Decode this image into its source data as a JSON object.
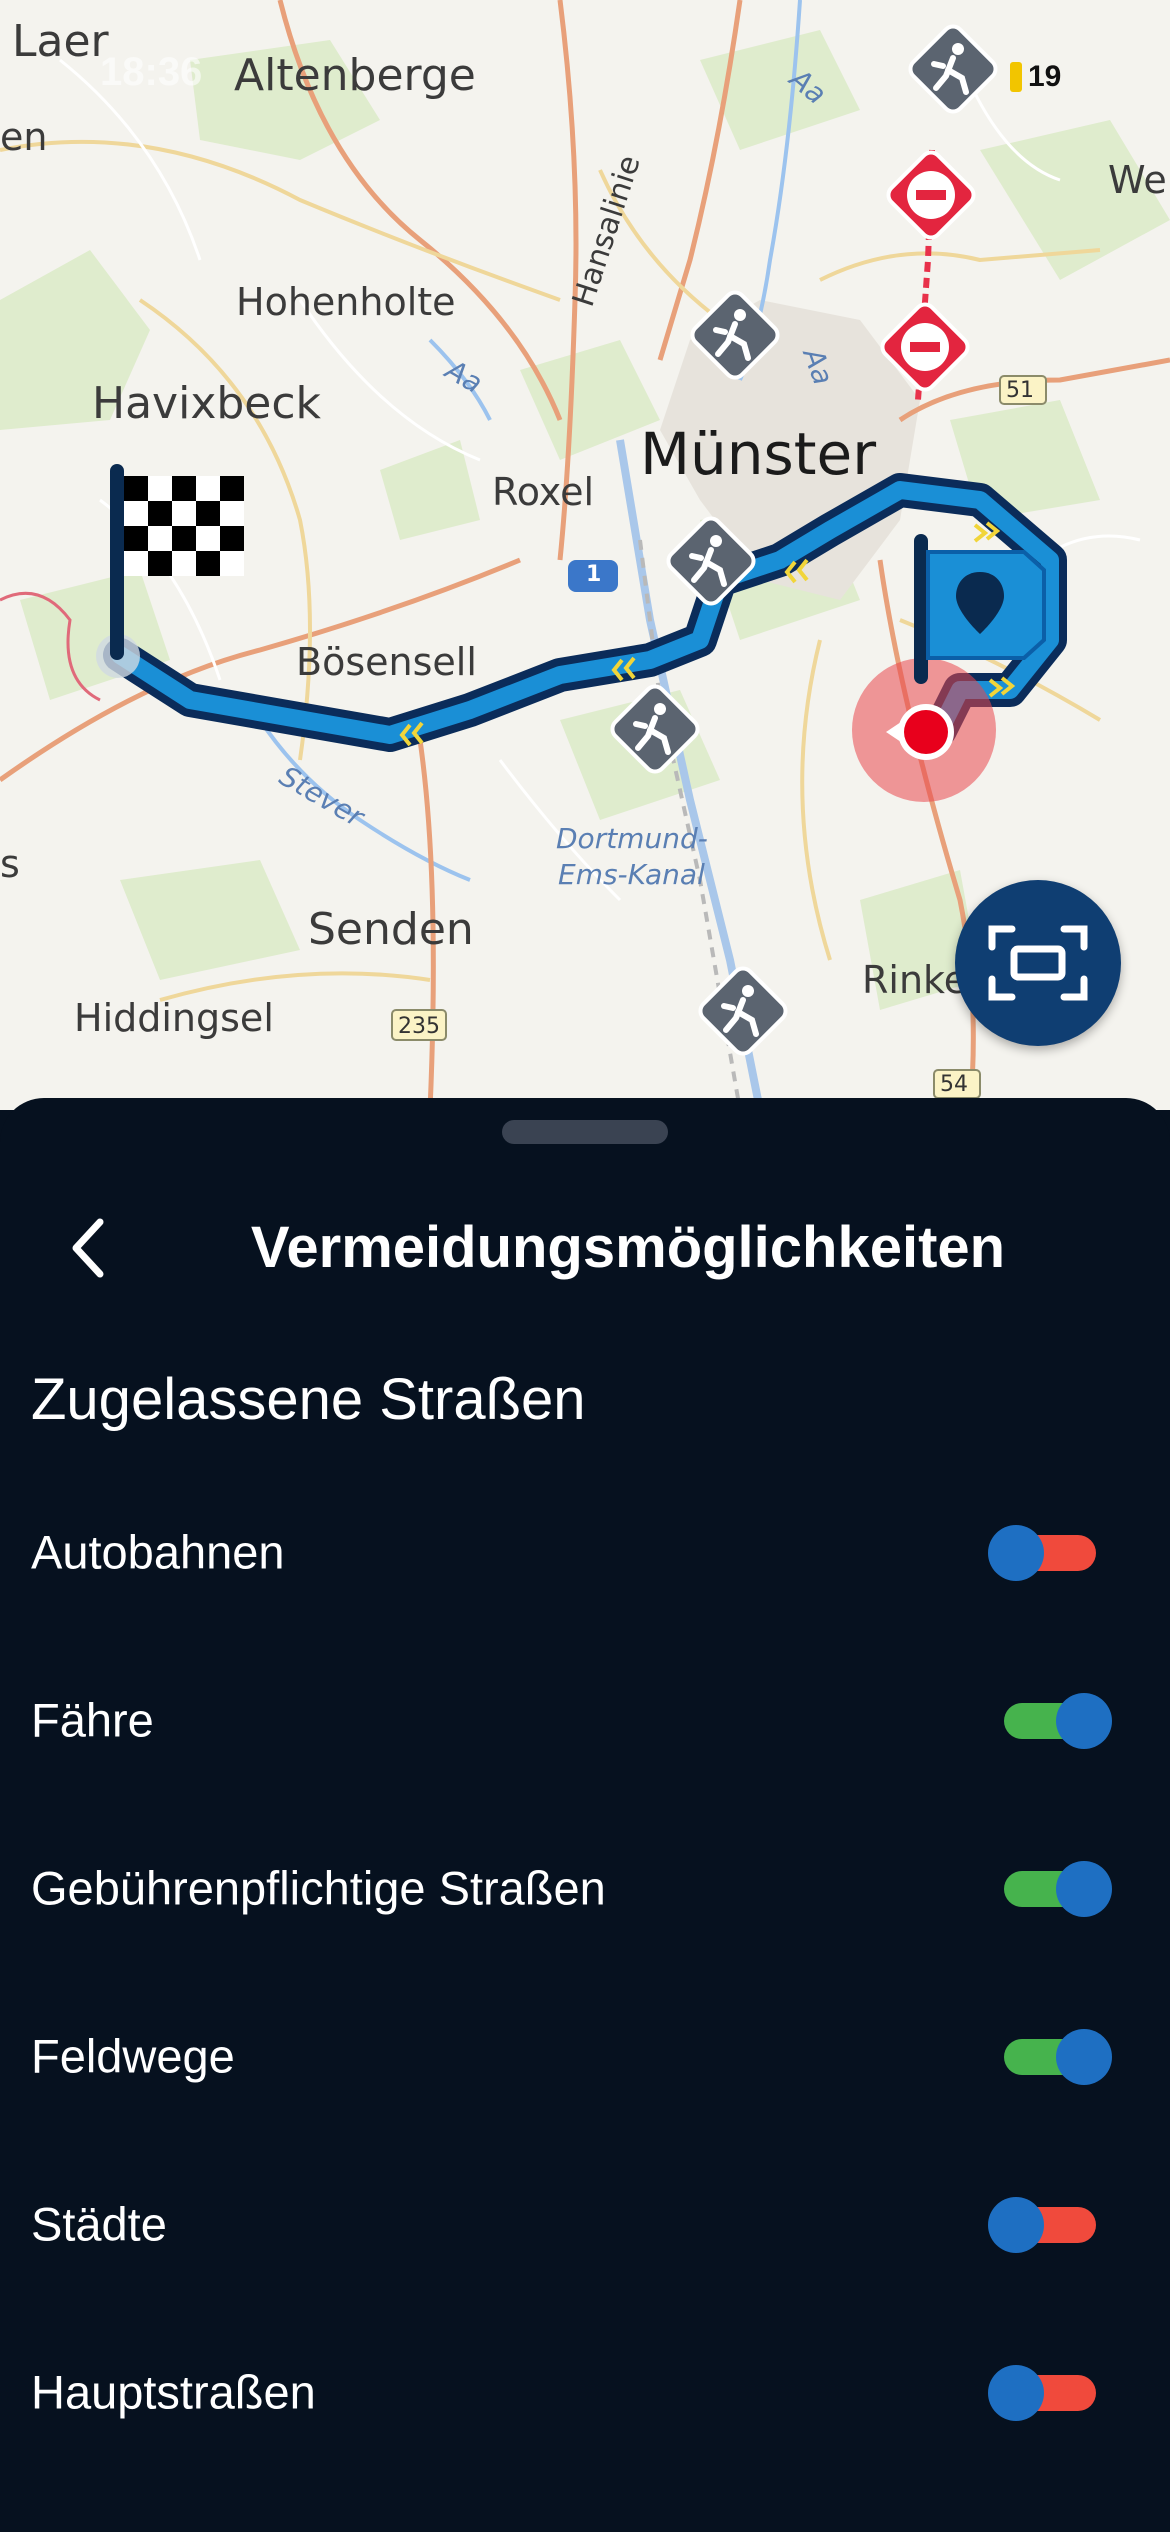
{
  "status": {
    "time": "18:36",
    "battery": "19"
  },
  "map": {
    "labels": {
      "laer": "Laer",
      "altenberge": "Altenberge",
      "hohenholte": "Hohenholte",
      "havixbeck": "Havixbeck",
      "munster": "Münster",
      "roxel": "Roxel",
      "bosensell": "Bösensell",
      "senden": "Senden",
      "hiddingsel": "Hiddingsel",
      "rinke": "Rinke",
      "we": "We",
      "en": "en",
      "s": "s",
      "hansalinie": "Hansalinie",
      "stever": "Stever",
      "aa1": "Aa",
      "aa2": "Aa",
      "aa3": "Aa",
      "dortmund1": "Dortmund-",
      "dortmund2": "Ems-Kanal",
      "road1": "1",
      "road51": "51",
      "road235": "235",
      "road54": "54"
    }
  },
  "sheet": {
    "title": "Vermeidungsmöglichkeiten",
    "section": "Zugelassene Straßen",
    "options": [
      {
        "label": "Autobahnen",
        "enabled": false
      },
      {
        "label": "Fähre",
        "enabled": true
      },
      {
        "label": "Gebührenpflichtige Straßen",
        "enabled": true
      },
      {
        "label": "Feldwege",
        "enabled": true
      },
      {
        "label": "Städte",
        "enabled": false
      },
      {
        "label": "Hauptstraßen",
        "enabled": false
      }
    ]
  },
  "colors": {
    "sheet_bg": "#06111f",
    "toggle_on": "#46b34d",
    "toggle_off": "#f04a3c",
    "knob": "#1e6fc2",
    "route": "#1a8fd6"
  }
}
